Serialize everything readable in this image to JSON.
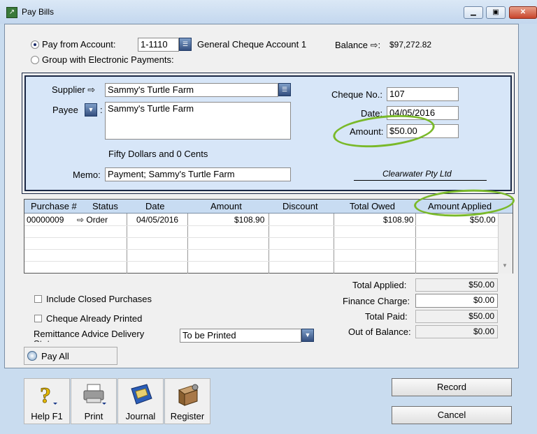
{
  "window": {
    "title": "Pay Bills"
  },
  "pay_from": {
    "radio_account_label": "Pay from Account:",
    "account_code": "1-1110",
    "account_name": "General Cheque Account 1",
    "balance_label": "Balance ⇨:",
    "balance_value": "$97,272.82",
    "radio_group_label": "Group with Electronic Payments:"
  },
  "payment": {
    "supplier_label": "Supplier ⇨",
    "supplier_value": "Sammy's Turtle Farm",
    "payee_label": "Payee",
    "payee_value": "Sammy's Turtle Farm",
    "amount_words": "Fifty Dollars and 0 Cents",
    "memo_label": "Memo:",
    "memo_value": "Payment; Sammy's Turtle Farm",
    "cheque_no_label": "Cheque No.:",
    "cheque_no_value": "107",
    "date_label": "Date:",
    "date_value": "04/05/2016",
    "amount_label": "Amount:",
    "amount_value": "$50.00",
    "company_signature": "Clearwater Pty Ltd"
  },
  "table": {
    "headers": [
      "Purchase #",
      "Status",
      "Date",
      "Amount",
      "Discount",
      "Total Owed",
      "Amount Applied"
    ],
    "rows": [
      {
        "purchase": "00000009",
        "status": "⇨ Order",
        "date": "04/05/2016",
        "amount": "$108.90",
        "discount": "",
        "total_owed": "$108.90",
        "applied": "$50.00"
      }
    ]
  },
  "options": {
    "include_closed": "Include Closed Purchases",
    "cheque_printed": "Cheque Already Printed",
    "remittance_label": "Remittance Advice Delivery Status",
    "remittance_value": "To be Printed",
    "pay_all_label": "Pay All"
  },
  "summary": {
    "total_applied_label": "Total Applied:",
    "total_applied_value": "$50.00",
    "finance_charge_label": "Finance Charge:",
    "finance_charge_value": "$0.00",
    "total_paid_label": "Total Paid:",
    "total_paid_value": "$50.00",
    "out_of_balance_label": "Out of Balance:",
    "out_of_balance_value": "$0.00"
  },
  "toolbar": {
    "help_label": "Help F1",
    "print_label": "Print",
    "journal_label": "Journal",
    "register_label": "Register"
  },
  "actions": {
    "record_label": "Record",
    "cancel_label": "Cancel"
  },
  "colors": {
    "panel_bg": "#d7e6f8",
    "accent_green": "#7ab92a",
    "header_bg": "#c8dcf2"
  }
}
